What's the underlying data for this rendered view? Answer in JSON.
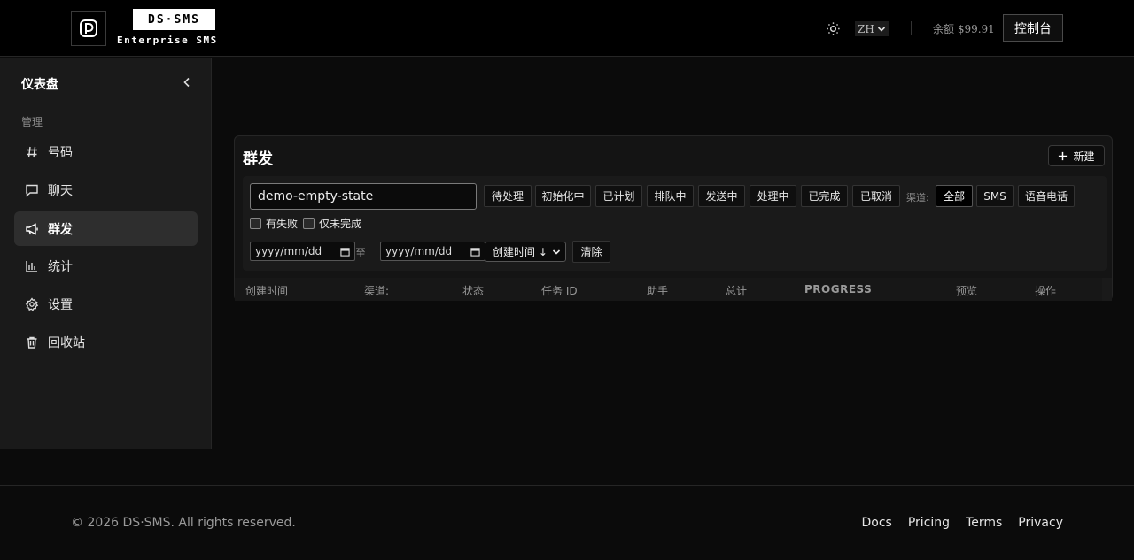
{
  "header": {
    "brand_name": "DS·SMS",
    "brand_tagline": "Enterprise SMS",
    "language": "ZH",
    "balance": "余额 $99.91",
    "console_label": "控制台"
  },
  "sidebar": {
    "title": "仪表盘",
    "group_label": "管理",
    "items": [
      {
        "label": "号码",
        "icon": "hash-icon"
      },
      {
        "label": "聊天",
        "icon": "chat-icon"
      },
      {
        "label": "群发",
        "icon": "megaphone-icon",
        "active": true
      },
      {
        "label": "统计",
        "icon": "bar-chart-icon"
      },
      {
        "label": "设置",
        "icon": "gear-icon"
      },
      {
        "label": "回收站",
        "icon": "trash-icon"
      }
    ]
  },
  "main": {
    "title": "群发",
    "new_button": "新建",
    "search": {
      "value": "demo-empty-state"
    },
    "status_filters": [
      "待处理",
      "初始化中",
      "已计划",
      "排队中",
      "发送中",
      "处理中",
      "已完成",
      "已取消"
    ],
    "channel_label": "渠道:",
    "channel_filters": [
      "全部",
      "SMS",
      "语音电话"
    ],
    "channel_active": "全部",
    "checkboxes": [
      "有失败",
      "仅未完成"
    ],
    "date_placeholder": "yyyy/mm/dd",
    "date_separator": "至",
    "sort_value": "创建时间 ↓",
    "clear_button": "清除",
    "columns": [
      "创建时间",
      "渠道:",
      "状态",
      "任务 ID",
      "助手",
      "总计",
      "PROGRESS",
      "预览",
      "操作"
    ]
  },
  "footer": {
    "copyright": "© 2026 DS·SMS. All rights reserved.",
    "links": [
      "Docs",
      "Pricing",
      "Terms",
      "Privacy"
    ]
  },
  "colors": {
    "background": "#0b0b0b",
    "sidebar": "#1a1a1a",
    "active_item": "#2e2e2e",
    "accent": "#ffffff"
  }
}
